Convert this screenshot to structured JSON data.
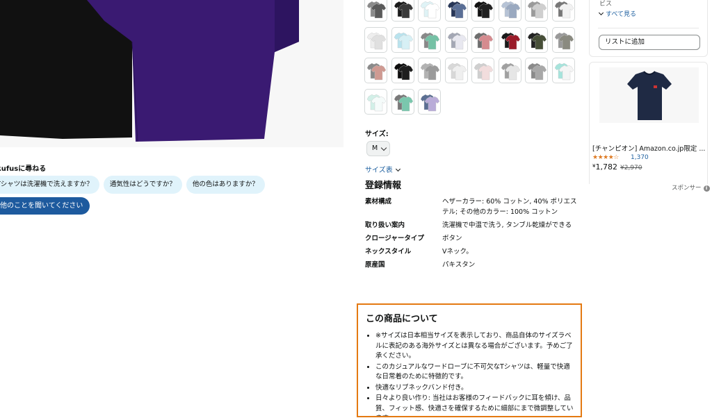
{
  "rufus": {
    "title": "Rufusに尋ねる",
    "chips": [
      "Tシャツは洗濯機で洗えますか？",
      "通気性はどうですか？",
      "他の色はありますか？"
    ],
    "ask_button": "他のことを聞いてください"
  },
  "swatches": [
    {
      "colors": [
        "#8a8a8a",
        "#5a5a5a"
      ]
    },
    {
      "colors": [
        "#1a1a1a",
        "#3a3a3a"
      ]
    },
    {
      "colors": [
        "#dff3f6",
        "#ffffff"
      ]
    },
    {
      "colors": [
        "#273657",
        "#5a6f96"
      ]
    },
    {
      "colors": [
        "#111111",
        "#222222"
      ]
    },
    {
      "colors": [
        "#b6c3d6",
        "#9aa9c0"
      ]
    },
    {
      "colors": [
        "#9a9a9a",
        "#cfcfcf"
      ]
    },
    {
      "colors": [
        "#777777",
        "#f2f2f2"
      ]
    },
    {
      "colors": [
        "#eeeeee",
        "#e0e0e0"
      ]
    },
    {
      "colors": [
        "#b9e3ee",
        "#d7f0f5"
      ]
    },
    {
      "colors": [
        "#888888",
        "#75c1a5"
      ]
    },
    {
      "colors": [
        "#a3a7b4",
        "#e8e8f0"
      ]
    },
    {
      "colors": [
        "#6d6d6d",
        "#d58b8f"
      ]
    },
    {
      "colors": [
        "#1a1a1a",
        "#9b1c2a"
      ]
    },
    {
      "colors": [
        "#222222",
        "#474f38"
      ]
    },
    {
      "colors": [
        "#999999",
        "#8a8a80"
      ]
    },
    {
      "colors": [
        "#8a8a8a",
        "#cf9a92"
      ]
    },
    {
      "colors": [
        "#0d0d0d",
        "#1e1e1e"
      ]
    },
    {
      "colors": [
        "#b2b2b2",
        "#9a9a9a"
      ]
    },
    {
      "colors": [
        "#d8d8d8",
        "#efefef"
      ]
    },
    {
      "colors": [
        "#cfcfcf",
        "#f2dddd"
      ]
    },
    {
      "colors": [
        "#a0a0a0",
        "#e6e6e6"
      ]
    },
    {
      "colors": [
        "#8a8a8a",
        "#a8a8a8"
      ]
    },
    {
      "colors": [
        "#a6e4dc",
        "#f5f5f5"
      ]
    },
    {
      "colors": [
        "#d2f0e8",
        "#f5fbfa"
      ]
    },
    {
      "colors": [
        "#797979",
        "#7ac7ad"
      ]
    },
    {
      "colors": [
        "#5b6f93",
        "#b9acd8"
      ]
    }
  ],
  "size": {
    "label": "サイズ:",
    "selected": "M",
    "chart_link": "サイズ表"
  },
  "registration": {
    "title": "登録情報",
    "rows": [
      {
        "key": "素材構成",
        "value": "ヘザーカラー: 60% コットン, 40% ポリエステル; その他のカラー: 100% コットン"
      },
      {
        "key": "取り扱い案内",
        "value": "洗濯機で中温で洗う, タンブル乾燥ができる"
      },
      {
        "key": "クロージャータイプ",
        "value": "ボタン"
      },
      {
        "key": "ネックスタイル",
        "value": "Vネック。"
      },
      {
        "key": "原産国",
        "value": "パキスタン"
      }
    ]
  },
  "about": {
    "title": "この商品について",
    "bullets": [
      "※サイズは日本相当サイズを表示しており、商品自体のサイズラベルに表記のある海外サイズとは異なる場合がございます。予めご了承ください。",
      "このカジュアルなワードローブに不可欠なTシャツは、軽量で快適な日常着のために特徴的です。",
      "快適なリブネックバンド付き。",
      "日々より良い作り: 当社はお客様のフィードバックに耳を傾け、品質、フィット感、快適さを確保するために細部にまで微調整しています。"
    ]
  },
  "right_panel": {
    "partial_text": "ビス",
    "see_all": "すべて見る",
    "add_to_list": "リストに追加"
  },
  "sponsored": {
    "title": "[チャンピオン] Amazon.co.jp限定 ...",
    "stars": "★★★★☆",
    "rating": 4,
    "review_count": "1,370",
    "currency": "¥",
    "price": "1,782",
    "old_price": "¥2,970",
    "sponsor_label": "スポンサー"
  },
  "colors": {
    "link": "#2162a1",
    "highlight_border": "#e47911",
    "chip_bg": "#e0f3fb",
    "primary_button": "#1d5a9e",
    "star": "#de7921",
    "product_main": "#3a1a72"
  }
}
